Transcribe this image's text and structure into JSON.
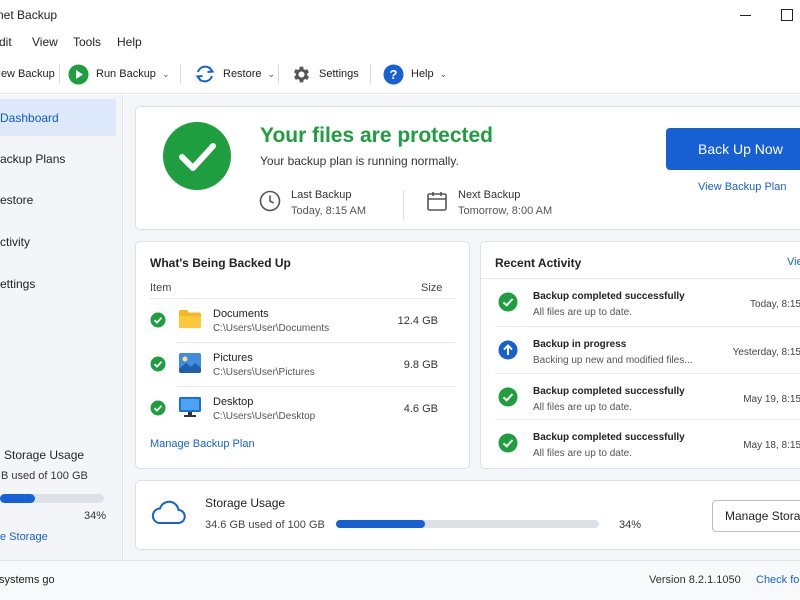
{
  "window": {
    "title": "net Backup"
  },
  "menu": [
    "dit",
    "View",
    "Tools",
    "Help"
  ],
  "toolbar": {
    "new_backup": "New Backup",
    "run_backup": "Run Backup",
    "restore": "Restore",
    "settings": "Settings",
    "help": "Help"
  },
  "sidebar": {
    "items": [
      {
        "label": "Dashboard",
        "active": true
      },
      {
        "label": "ackup Plans"
      },
      {
        "label": "estore"
      },
      {
        "label": "ctivity"
      },
      {
        "label": "ettings"
      }
    ],
    "storage": {
      "title": "Storage Usage",
      "used": "B used of 100 GB",
      "percent": 34,
      "percent_label": "34%",
      "link": "e Storage"
    }
  },
  "hero": {
    "headline": "Your files are protected",
    "subtitle": "Your backup plan is running normally.",
    "last_backup_label": "Last Backup",
    "last_backup_value": "Today, 8:15 AM",
    "next_backup_label": "Next Backup",
    "next_backup_value": "Tomorrow, 8:00 AM",
    "back_up_now": "Back Up Now",
    "view_plan": "View Backup Plan"
  },
  "backed_up": {
    "title": "What's Being Backed Up",
    "col_item": "Item",
    "col_size": "Size",
    "rows": [
      {
        "name": "Documents",
        "path": "C:\\Users\\User\\Documents",
        "size": "12.4 GB",
        "icon": "folder-icon"
      },
      {
        "name": "Pictures",
        "path": "C:\\Users\\User\\Pictures",
        "size": "9.8 GB",
        "icon": "pictures-icon"
      },
      {
        "name": "Desktop",
        "path": "C:\\Users\\User\\Desktop",
        "size": "4.6 GB",
        "icon": "monitor-icon"
      }
    ],
    "manage": "Manage Backup Plan"
  },
  "activity": {
    "title": "Recent Activity",
    "view_all": "Vie",
    "rows": [
      {
        "title": "Backup completed successfully",
        "sub": "All files are up to date.",
        "time": "Today, 8:15",
        "status": "success"
      },
      {
        "title": "Backup in progress",
        "sub": "Backing up new and modified files...",
        "time": "Yesterday, 8:15",
        "status": "progress"
      },
      {
        "title": "Backup completed successfully",
        "sub": "All files are up to date.",
        "time": "May 19, 8:15",
        "status": "success"
      },
      {
        "title": "Backup completed successfully",
        "sub": "All files are up to date.",
        "time": "May 18, 8:15",
        "status": "success"
      }
    ]
  },
  "storage_card": {
    "title": "Storage Usage",
    "used": "34.6 GB used of 100 GB",
    "percent": 34,
    "percent_label": "34%",
    "manage": "Manage Storag"
  },
  "status": {
    "left": "systems go",
    "version": "Version 8.2.1.1050",
    "update": "Check for"
  },
  "colors": {
    "accent": "#1660d4",
    "success": "#1e9e3e",
    "sidebar_active": "#dde9fb"
  }
}
